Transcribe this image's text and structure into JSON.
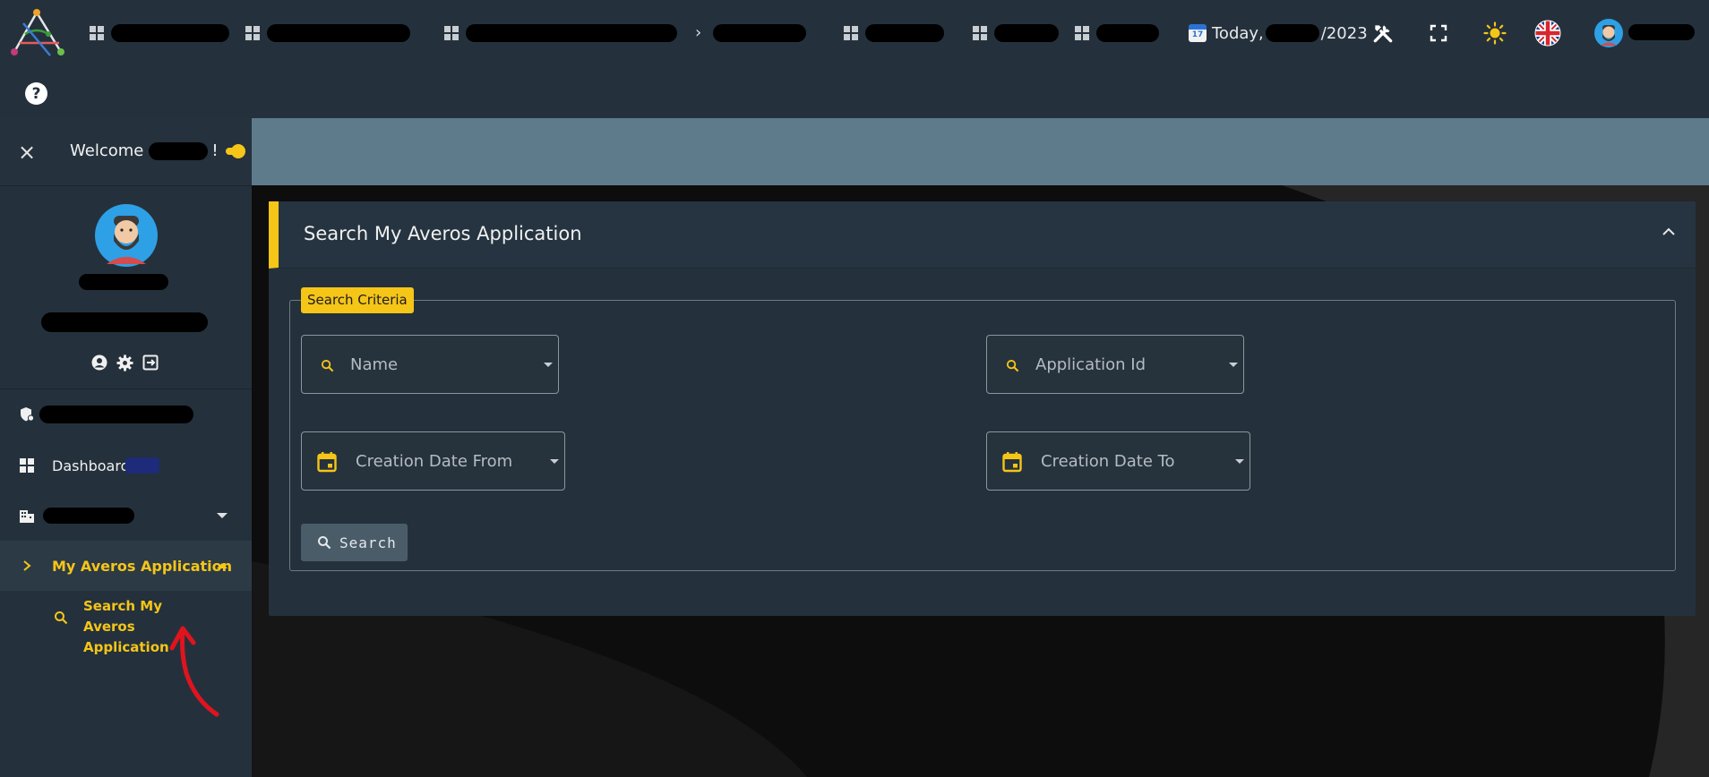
{
  "topbar": {
    "nav_separator": "›",
    "today_prefix": "Today,",
    "today_year": "/2023",
    "calendar_day": "17"
  },
  "help_label": "?",
  "sidebar": {
    "close_label": "×",
    "welcome_prefix": "Welcome",
    "welcome_suffix": "!",
    "items": [
      {
        "label": "Dashboard",
        "icon": "dashboard-icon"
      },
      {
        "label": "My Averos Application",
        "icon": "chevron-right-icon"
      }
    ],
    "sub_item": {
      "label": "Search My Averos Application",
      "icon": "search-icon"
    }
  },
  "card": {
    "title": "Search My Averos Application",
    "legend": "Search Criteria",
    "fields": {
      "name": "Name",
      "application_id": "Application Id",
      "creation_from": "Creation Date From",
      "creation_to": "Creation Date To"
    },
    "search_button": "Search"
  },
  "colors": {
    "accent": "#f5c518",
    "topbar": "#24313c",
    "header_band": "#5e7b8c",
    "annotation_arrow": "#e0141e"
  }
}
